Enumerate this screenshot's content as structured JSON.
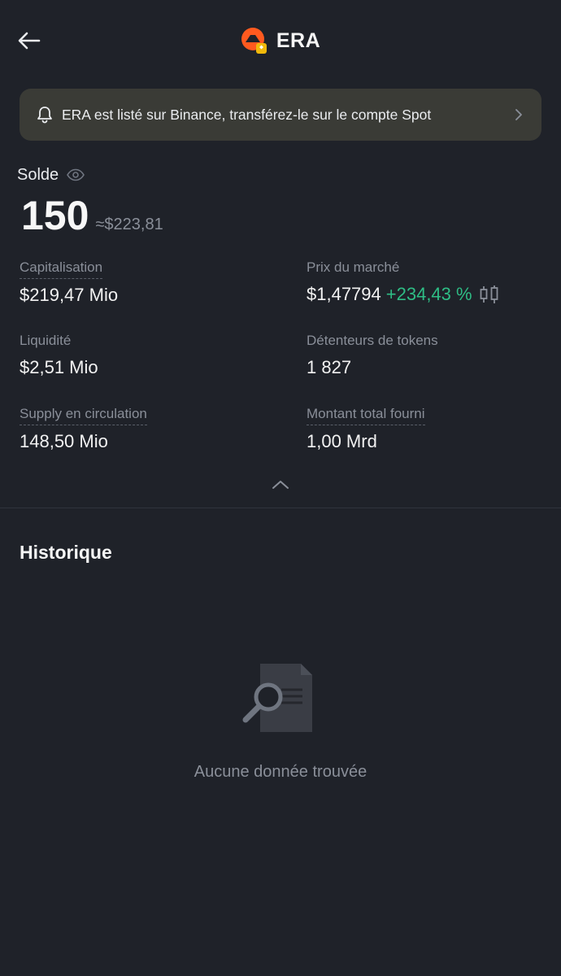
{
  "header": {
    "title": "ERA",
    "back_icon": "arrow-left-icon",
    "logo_colors": {
      "primary": "#ff5a1f",
      "badge": "#f0b90b"
    }
  },
  "notice": {
    "icon": "bell-icon",
    "text": "ERA est listé sur Binance, transférez-le sur le compte Spot",
    "chevron_icon": "chevron-right-icon"
  },
  "balance": {
    "label": "Solde",
    "eye_icon": "eye-icon",
    "amount": "150",
    "fiat": "≈$223,81"
  },
  "stats": {
    "market_cap": {
      "label": "Capitalisation",
      "value": "$219,47 Mio"
    },
    "market_price": {
      "label": "Prix du marché",
      "value": "$1,47794",
      "change": "+234,43 %"
    },
    "liquidity": {
      "label": "Liquidité",
      "value": "$2,51 Mio"
    },
    "holders": {
      "label": "Détenteurs de tokens",
      "value": "1 827"
    },
    "circulating_supply": {
      "label": "Supply en circulation",
      "value": "148,50 Mio"
    },
    "total_supply": {
      "label": "Montant total fourni",
      "value": "1,00 Mrd"
    }
  },
  "history": {
    "title": "Historique",
    "empty_text": "Aucune donnée trouvée"
  },
  "colors": {
    "background": "#1f2229",
    "positive": "#2ebd85",
    "muted": "#8a8f99"
  }
}
